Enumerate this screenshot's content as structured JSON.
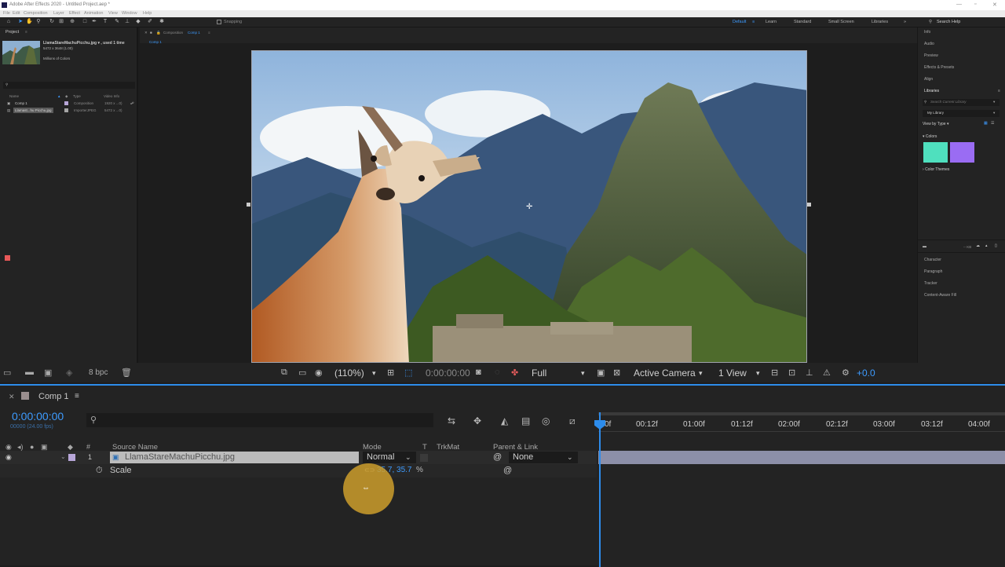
{
  "titlebar": {
    "title": "Adobe After Effects 2020 - Untitled Project.aep *"
  },
  "menu": [
    "File",
    "Edit",
    "Composition",
    "Layer",
    "Effect",
    "Animation",
    "View",
    "Window",
    "Help"
  ],
  "toolbar": {
    "snapping": "Snapping"
  },
  "workspaces": [
    "Default",
    "Learn",
    "Standard",
    "Small Screen",
    "Libraries"
  ],
  "search_help": "Search Help",
  "project": {
    "tab": "Project",
    "footage_name": "LlamaStareMachuPicchu.jpg ▾ , used 1 time",
    "footage_dims": "5472 x 3648 (1.00)",
    "footage_colors": "Millions of Colors",
    "columns": {
      "name": "Name",
      "type": "Type",
      "video_info": "Video Info"
    },
    "items": [
      {
        "name": "Comp 1",
        "type": "Composition",
        "info": "1920 x ...0)"
      },
      {
        "name": "Llamast...hu Picchu.jpg",
        "type": "ImporterJPEG",
        "info": "5472 x ...0)"
      }
    ],
    "bpc": "8 bpc"
  },
  "viewer": {
    "comp_tab": "Composition",
    "comp_name": "Comp 1",
    "breadcrumb": "Comp 1",
    "zoom": "(110%)",
    "time": "0:00:00:00",
    "resolution": "Full",
    "camera": "Active Camera",
    "views": "1 View",
    "exposure": "+0.0"
  },
  "right_panel": {
    "items": [
      "Info",
      "Audio",
      "Preview",
      "Effects & Presets",
      "Align"
    ],
    "libraries": "Libraries",
    "search_placeholder": "Search Current Library",
    "library": "My Library",
    "view_by": "View by Type ▾",
    "colors": "Colors",
    "color_themes": "Color Themes",
    "swatches": [
      "#4fe0be",
      "#9a6cf3"
    ],
    "size": "-- KB",
    "lower_items": [
      "Character",
      "Paragraph",
      "Tracker",
      "Content-Aware Fill"
    ]
  },
  "timeline": {
    "comp_name": "Comp 1",
    "timecode": "0:00:00:00",
    "fps": "00000 (24.00 fps)",
    "columns": {
      "source_name": "Source Name",
      "mode": "Mode",
      "t": "T",
      "trkmat": "TrkMat",
      "parent": "Parent & Link"
    },
    "layer": {
      "number": "1",
      "name": "LlamaStareMachuPicchu.jpg",
      "mode": "Normal",
      "parent": "None"
    },
    "property": {
      "name": "Scale",
      "value": "35.7, 35.7",
      "unit": "%"
    },
    "ruler": [
      "0f",
      "00:12f",
      "01:00f",
      "01:12f",
      "02:00f",
      "02:12f",
      "03:00f",
      "03:12f",
      "04:00f"
    ]
  }
}
